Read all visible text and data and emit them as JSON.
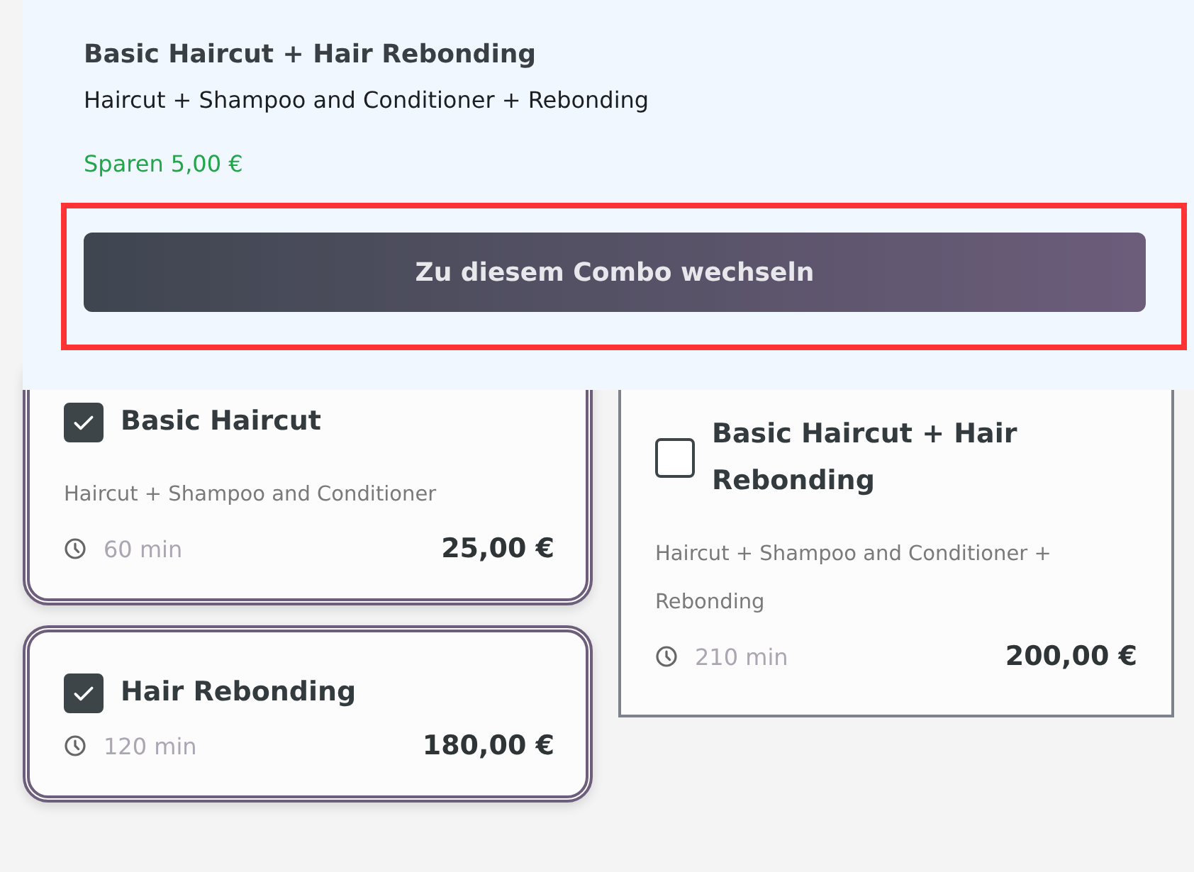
{
  "combo_popup": {
    "title": "Basic Haircut + Hair Rebonding",
    "description": "Haircut + Shampoo and Conditioner + Rebonding",
    "savings": "Sparen 5,00 €",
    "button": "Zu diesem Combo wechseln"
  },
  "columns": [
    {
      "cards": [
        {
          "title": "Basic Haircut",
          "description": "Haircut + Shampoo and Conditioner",
          "duration": "60 min",
          "price": "25,00 €",
          "checked": true
        },
        {
          "title": "Hair Rebonding",
          "duration": "120 min",
          "price": "180,00 €",
          "checked": true
        }
      ]
    },
    {
      "cards": [
        {
          "title": "Basic Haircut + Hair Rebonding",
          "description": "Haircut + Shampoo and Conditioner + Rebonding",
          "duration": "210 min",
          "price": "200,00 €",
          "checked": false
        }
      ]
    }
  ]
}
